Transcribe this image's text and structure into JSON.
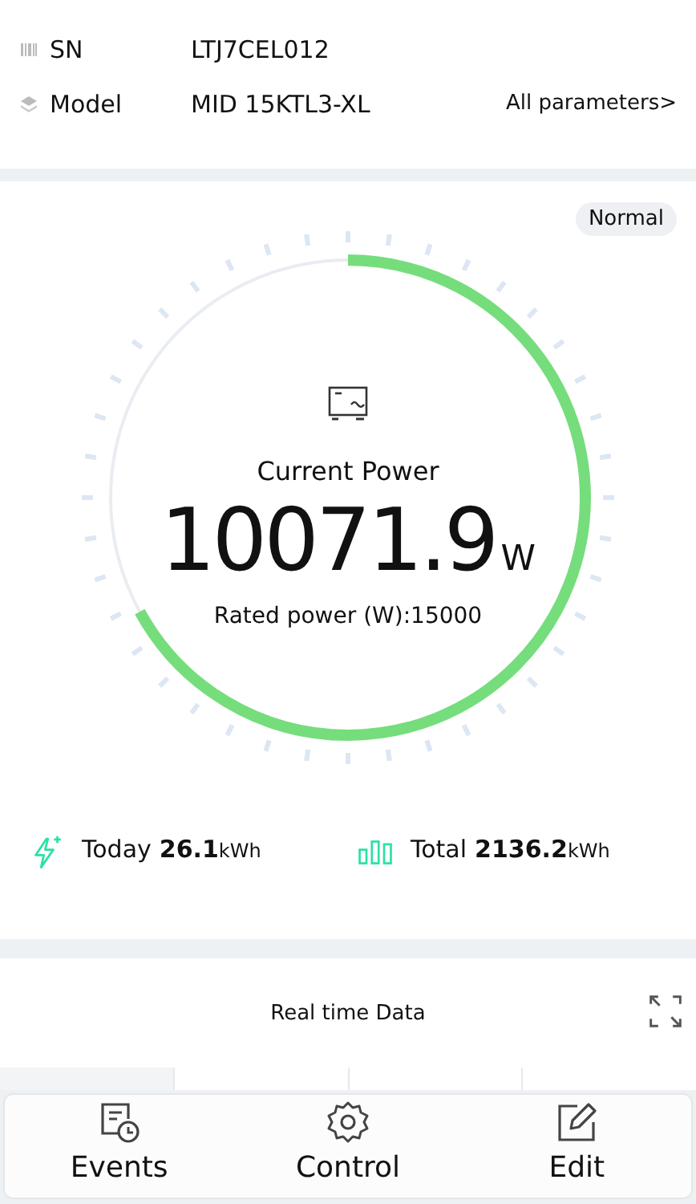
{
  "device_info": {
    "rows": [
      {
        "kind": "sn",
        "label": "SN",
        "value": "LTJ7CEL012"
      },
      {
        "kind": "model",
        "label": "Model",
        "value": "MID 15KTL3-XL"
      }
    ],
    "link": "All parameters>"
  },
  "status_badge": "Normal",
  "gauge": {
    "title": "Current Power",
    "value": "10071.9",
    "unit": "W",
    "level": 0.67,
    "rated": "Rated power (W):15000"
  },
  "stats": [
    {
      "kind": "today",
      "label": "Today",
      "value": "26.1",
      "unit": "kWh"
    },
    {
      "kind": "total",
      "label": "Total",
      "value": "2136.2",
      "unit": "kWh"
    }
  ],
  "realtime": {
    "title": "Real time Data"
  },
  "bottom_nav": [
    {
      "kind": "events",
      "label": "Events"
    },
    {
      "kind": "control",
      "label": "Control"
    },
    {
      "kind": "edit",
      "label": "Edit"
    }
  ]
}
